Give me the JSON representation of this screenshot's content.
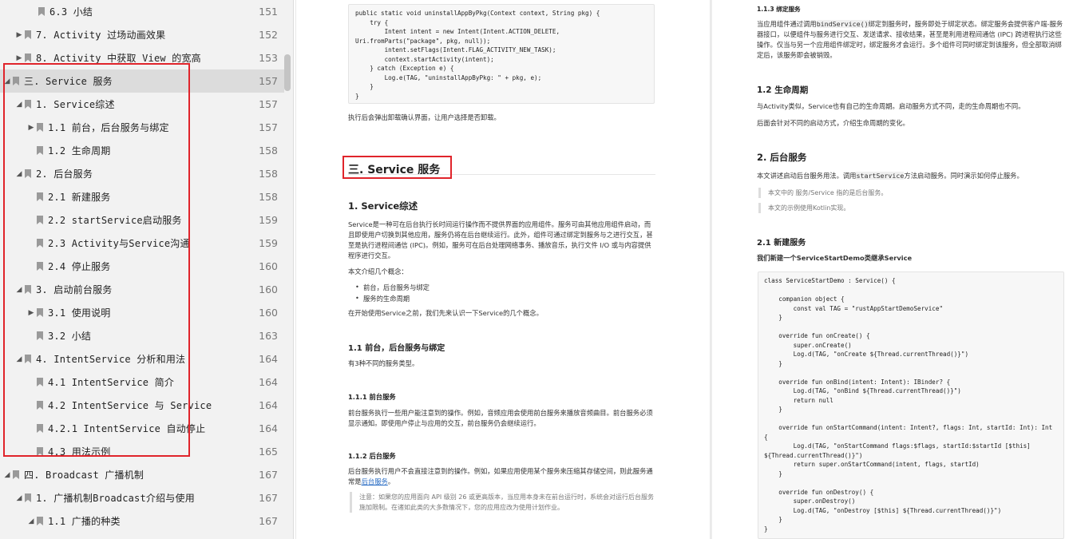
{
  "toc": {
    "items": [
      {
        "label": "6.3 小结",
        "page": "151",
        "arrow": ""
      },
      {
        "label": "7. Activity 过场动画效果",
        "page": "152",
        "arrow": "▶"
      },
      {
        "label": "8. Activity 中获取 View 的宽高",
        "page": "153",
        "arrow": "▶"
      },
      {
        "label": "三. Service 服务",
        "page": "157",
        "arrow": "◢"
      },
      {
        "label": "1. Service综述",
        "page": "157",
        "arrow": "◢"
      },
      {
        "label": "1.1 前台，后台服务与绑定",
        "page": "157",
        "arrow": "▶"
      },
      {
        "label": "1.2 生命周期",
        "page": "158",
        "arrow": ""
      },
      {
        "label": "2. 后台服务",
        "page": "158",
        "arrow": "◢"
      },
      {
        "label": "2.1 新建服务",
        "page": "158",
        "arrow": ""
      },
      {
        "label": "2.2 startService启动服务",
        "page": "159",
        "arrow": ""
      },
      {
        "label": "2.3 Activity与Service沟通",
        "page": "159",
        "arrow": ""
      },
      {
        "label": "2.4 停止服务",
        "page": "160",
        "arrow": ""
      },
      {
        "label": "3. 启动前台服务",
        "page": "160",
        "arrow": "◢"
      },
      {
        "label": "3.1 使用说明",
        "page": "160",
        "arrow": "▶"
      },
      {
        "label": "3.2 小结",
        "page": "163",
        "arrow": ""
      },
      {
        "label": "4. IntentService 分析和用法",
        "page": "164",
        "arrow": "◢"
      },
      {
        "label": "4.1 IntentService 简介",
        "page": "164",
        "arrow": ""
      },
      {
        "label": "4.2 IntentService 与 Service",
        "page": "164",
        "arrow": ""
      },
      {
        "label": "4.2.1 IntentService 自动停止",
        "page": "164",
        "arrow": ""
      },
      {
        "label": "4.3 用法示例",
        "page": "165",
        "arrow": ""
      },
      {
        "label": "四. Broadcast 广播机制",
        "page": "167",
        "arrow": "◢"
      },
      {
        "label": "1. 广播机制Broadcast介绍与使用",
        "page": "167",
        "arrow": "◢"
      },
      {
        "label": "1.1 广播的种类",
        "page": "167",
        "arrow": "◢"
      }
    ]
  },
  "mid": {
    "code1": [
      "public static void uninstallAppByPkg(Context context, String pkg) {",
      "    try {",
      "        Intent intent = new Intent(Intent.ACTION_DELETE,",
      "Uri.fromParts(\"package\", pkg, null));",
      "        intent.setFlags(Intent.FLAG_ACTIVITY_NEW_TASK);",
      "        context.startActivity(intent);",
      "    } catch (Exception e) {",
      "        Log.e(TAG, \"uninstallAppByPkg: \" + pkg, e);",
      "    }",
      "}"
    ],
    "after_code": "执行后会弹出卸载确认界面，让用户选择是否卸载。",
    "section_title": "三. Service 服务",
    "h_overview": "1. Service综述",
    "overview_p1": "Service是一种可在后台执行长时间运行操作而不提供界面的应用组件。服务可由其他应用组件启动，而且即使用户切换到其他应用，服务仍将在后台继续运行。此外，组件可通过绑定到服务与之进行交互，甚至是执行进程间通信 (IPC)。例如，服务可在后台处理网络事务、播放音乐，执行文件 I/O 或与内容提供程序进行交互。",
    "overview_p2": "本文介绍几个概念：",
    "bullets": [
      "前台，后台服务与绑定",
      "服务的生命周期"
    ],
    "overview_p3": "在开始使用Service之前，我们先来认识一下Service的几个概念。",
    "h_11": "1.1 前台，后台服务与绑定",
    "p_11": "有3种不同的服务类型。",
    "h_111": "1.1.1 前台服务",
    "p_111": "前台服务执行一些用户能注意到的操作。例如，音频应用会使用前台服务来播放音频曲目。前台服务必须显示通知。即使用户停止与应用的交互，前台服务仍会继续运行。",
    "h_112": "1.1.2 后台服务",
    "p_112_a": "后台服务执行用户不会直接注意到的操作。例如，如果应用使用某个服务来压缩其存储空间，则此服务通常是",
    "p_112_link": "后台服务",
    "p_112_b": "。",
    "note": "注意：如果您的应用面向 API 级别 26 或更高版本，当应用本身未在前台运行时，系统会对运行后台服务施加限制。在诸如此类的大多数情况下，您的应用应改为使用计划作业。"
  },
  "right": {
    "h_113": "1.1.3 绑定服务",
    "p_113_a": "当应用组件通过调用",
    "p_113_code": "bindService()",
    "p_113_b": "绑定到服务时，服务即处于绑定状态。绑定服务会提供客户端-服务器接口，以便组件与服务进行交互、发送请求、接收结果，甚至是利用进程间通信 (IPC) 跨进程执行这些操作。仅当与另一个应用组件绑定时，绑定服务才会运行。多个组件可同时绑定到该服务，但全部取消绑定后，该服务即会被销毁。",
    "h_12": "1.2 生命周期",
    "p_12a": "与Activity类似，Service也有自己的生命周期。启动服务方式不同，走的生命周期也不同。",
    "p_12b": "后面会针对不同的启动方式，介绍生命周期的变化。",
    "h_2": "2. 后台服务",
    "p_2_a": "本文讲述启动后台服务用法。调用",
    "p_2_code": "startService",
    "p_2_b": "方法启动服务。同时演示如何停止服务。",
    "quote1": "本文中的 服务/Service 指的是后台服务。",
    "quote2": "本文的示例使用Kotlin实现。",
    "h_21": "2.1 新建服务",
    "p_21": "我们新建一个ServiceStartDemo类继承Service",
    "code2": [
      "class ServiceStartDemo : Service() {",
      "",
      "    companion object {",
      "        const val TAG = \"rustAppStartDemoService\"",
      "    }",
      "",
      "    override fun onCreate() {",
      "        super.onCreate()",
      "        Log.d(TAG, \"onCreate ${Thread.currentThread()}\")",
      "    }",
      "",
      "    override fun onBind(intent: Intent): IBinder? {",
      "        Log.d(TAG, \"onBind ${Thread.currentThread()}\")",
      "        return null",
      "    }",
      "",
      "    override fun onStartCommand(intent: Intent?, flags: Int, startId: Int): Int",
      "{",
      "        Log.d(TAG, \"onStartCommand flags:$flags, startId:$startId [$this]",
      "${Thread.currentThread()}\")",
      "        return super.onStartCommand(intent, flags, startId)",
      "    }",
      "",
      "    override fun onDestroy() {",
      "        super.onDestroy()",
      "        Log.d(TAG, \"onDestroy [$this] ${Thread.currentThread()}\")",
      "    }",
      "}"
    ]
  },
  "colors": {
    "highlight": "#e0242b",
    "sidebar_bg": "#f2f2f2",
    "selected_row": "#dcdcdc",
    "link": "#2a6dc4"
  },
  "icons": {
    "expanded": "triangle-down-icon",
    "collapsed": "triangle-right-icon",
    "bookmark": "bookmark-icon"
  }
}
